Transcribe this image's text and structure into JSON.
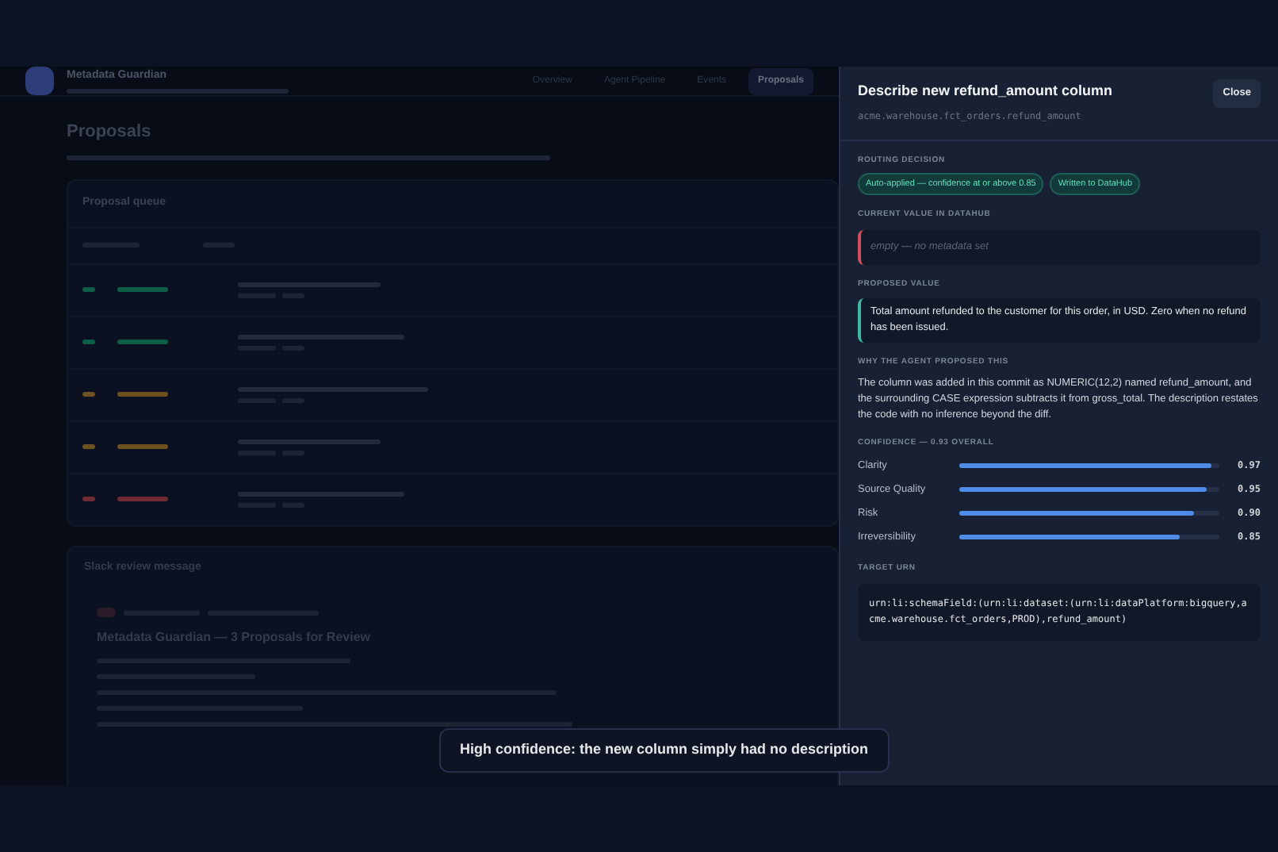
{
  "app": {
    "name": "Metadata Guardian",
    "nav": [
      {
        "label": "Overview",
        "selected": false
      },
      {
        "label": "Agent Pipeline",
        "selected": false
      },
      {
        "label": "Events",
        "selected": false
      },
      {
        "label": "Proposals",
        "selected": true
      }
    ]
  },
  "page": {
    "title": "Proposals"
  },
  "queue": {
    "title": "Proposal queue",
    "rows": [
      {
        "color": "#0d5e47"
      },
      {
        "color": "#0d5e47"
      },
      {
        "color": "#6e5120"
      },
      {
        "color": "#6e5120"
      },
      {
        "color": "#6e2a35"
      }
    ]
  },
  "slack": {
    "title": "Slack review message",
    "heading": "Metadata Guardian — 3 Proposals for Review"
  },
  "drawer": {
    "title": "Describe new refund_amount column",
    "subtitle": "acme.warehouse.fct_orders.refund_amount",
    "close": "Close",
    "routing": {
      "label": "ROUTING DECISION",
      "badges": [
        "Auto-applied — confidence at or above 0.85",
        "Written to DataHub"
      ]
    },
    "current": {
      "label": "CURRENT VALUE IN DATAHUB",
      "placeholder": "empty — no metadata set"
    },
    "proposed": {
      "label": "PROPOSED VALUE",
      "text": "Total amount refunded to the customer for this order, in USD. Zero when no refund has been issued."
    },
    "why": {
      "label": "WHY THE AGENT PROPOSED THIS",
      "text": "The column was added in this commit as NUMERIC(12,2) named refund_amount, and the surrounding CASE expression subtracts it from gross_total. The description restates the code with no inference beyond the diff."
    },
    "confidence": {
      "label": "CONFIDENCE — 0.93 OVERALL",
      "metrics": [
        {
          "name": "Clarity",
          "level": 0.97,
          "reading": "0.97"
        },
        {
          "name": "Source Quality",
          "level": 0.95,
          "reading": "0.95"
        },
        {
          "name": "Risk",
          "level": 0.9,
          "reading": "0.90"
        },
        {
          "name": "Irreversibility",
          "level": 0.85,
          "reading": "0.85"
        }
      ]
    },
    "urn": {
      "label": "TARGET URN",
      "value": "urn:li:schemaField:(urn:li:dataset:(urn:li:dataPlatform:bigquery,acme.warehouse.fct_orders,PROD),refund_amount)"
    }
  },
  "tooltip": {
    "text": "High confidence: the new column simply had no description"
  }
}
